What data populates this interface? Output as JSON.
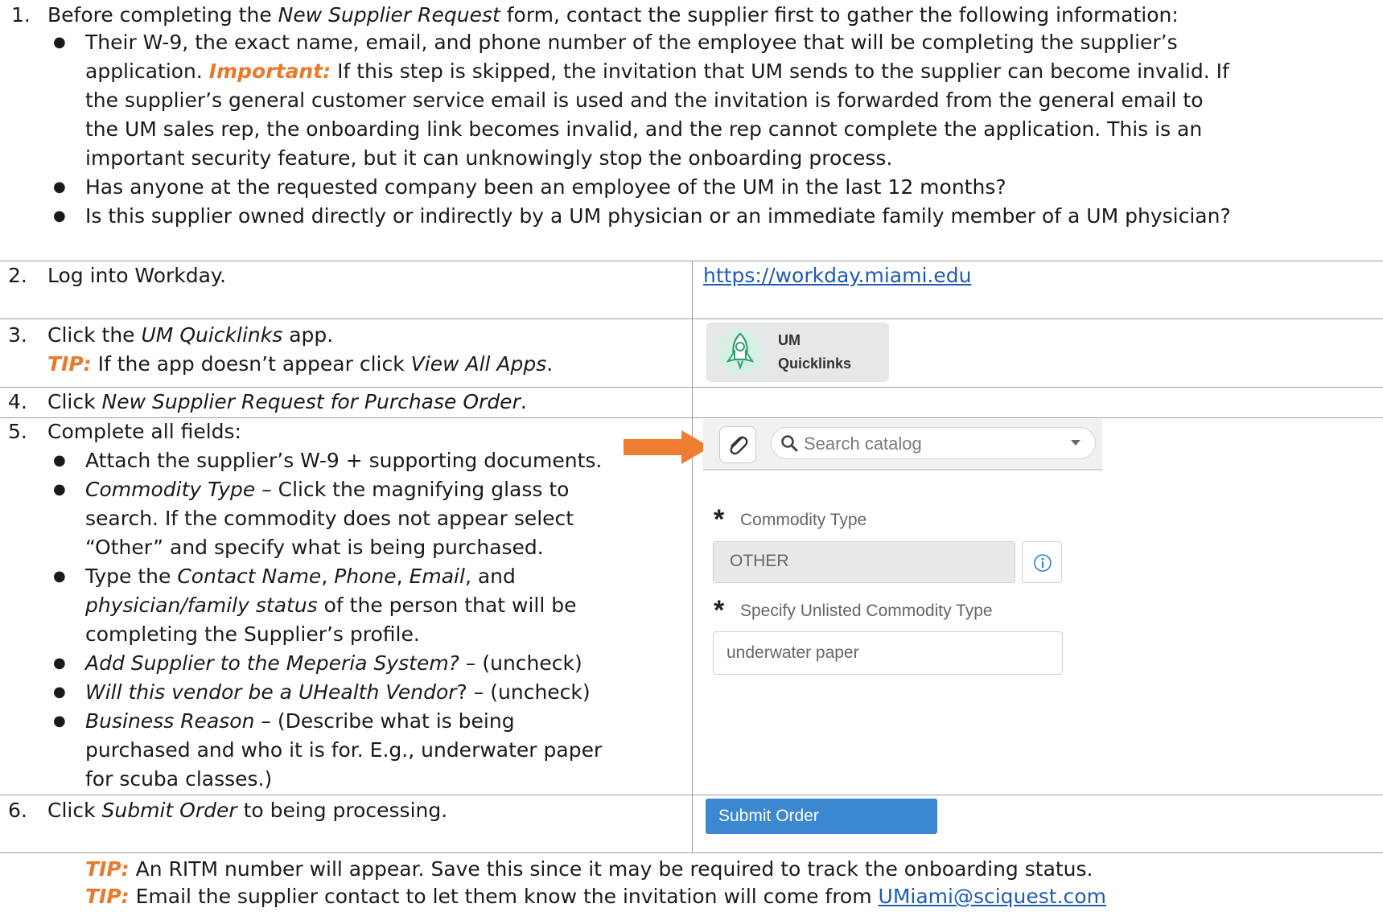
{
  "step1": {
    "number": "1.",
    "intro_a": "Before completing the ",
    "intro_form": "New Supplier Request",
    "intro_b": " form, contact the supplier first to gather the following information:",
    "bullet1_line1": "Their W-9, the exact name, email, and phone number of the employee that will be completing the supplier’s",
    "bullet1_line2a": "application. ",
    "important_label": "Important:",
    "bullet1_line2b": " If this step is skipped, the invitation that UM sends to the supplier can become invalid. If",
    "bullet1_line3": "the supplier’s general customer service email is used and the invitation is forwarded from the general email to",
    "bullet1_line4": "the UM sales rep, the onboarding link becomes invalid, and the rep cannot complete the application. This is an",
    "bullet1_line5": "important security feature, but it can unknowingly stop the onboarding process.",
    "bullet2": "Has anyone at the requested company been an employee of the UM in the last 12 months?",
    "bullet3": "Is this supplier owned directly or indirectly by a UM physician or an immediate family member of a UM physician?"
  },
  "step2": {
    "number": "2.",
    "text": "Log into Workday.",
    "link": "https://workday.miami.edu"
  },
  "step3": {
    "number": "3.",
    "text_a": "Click the ",
    "app_name": "UM Quicklinks",
    "text_b": " app.",
    "tip_label": "TIP:",
    "tip_a": " If the app doesn’t appear click ",
    "tip_link": "View All Apps",
    "tip_b": ".",
    "tile_line1": "UM",
    "tile_line2": "Quicklinks"
  },
  "step4": {
    "number": "4.",
    "text_a": "Click ",
    "item": "New Supplier Request for Purchase Order",
    "text_b": "."
  },
  "step5": {
    "number": "5.",
    "text": "Complete all fields:",
    "b1": "Attach the supplier’s W-9 + supporting documents.",
    "b2_field": "Commodity Type",
    "b2_line1": " – Click the magnifying glass to",
    "b2_line2": "search. If the commodity does not appear select",
    "b2_line3": "“Other” and specify what is being purchased.",
    "b3_a": "Type the ",
    "b3_contact": "Contact Name",
    "b3_comma1": ", ",
    "b3_phone": "Phone",
    "b3_comma2": ", ",
    "b3_email": "Email",
    "b3_and": ", and",
    "b3_status": "physician/family status",
    "b3_line2b": " of the person that will be",
    "b3_line3": "completing the Supplier’s profile.",
    "b4_q": "Add Supplier to the Meperia System?",
    "b4_a": " – (uncheck)",
    "b5_q": "Will this vendor be a UHealth Vendor",
    "b5_a": "? – (uncheck)",
    "b6_field": "Business Reason",
    "b6_line1": " – (Describe what is being",
    "b6_line2": "purchased and who it is for. E.g., underwater paper",
    "b6_line3": "for scuba classes.)",
    "search_placeholder": "Search catalog",
    "commodity_label": "Commodity Type",
    "commodity_value": "OTHER",
    "unlisted_label": "Specify Unlisted Commodity Type",
    "unlisted_value": "underwater paper"
  },
  "step6": {
    "number": "6.",
    "text_a": "Click ",
    "button_ref": "Submit Order",
    "text_b": " to being processing.",
    "button_label": "Submit Order"
  },
  "tips": {
    "tip_label": "TIP:",
    "tip1": " An RITM number will appear. Save this since it may be required to track the onboarding status.",
    "tip2": " Email the supplier contact to let them know the invitation will come from ",
    "tip2_link": "UMiami@sciquest.com"
  },
  "colors": {
    "accent_orange": "#e8792b",
    "link_blue": "#1f5bb4",
    "button_blue": "#3b87d0",
    "rocket_green": "#2e9e6e"
  }
}
